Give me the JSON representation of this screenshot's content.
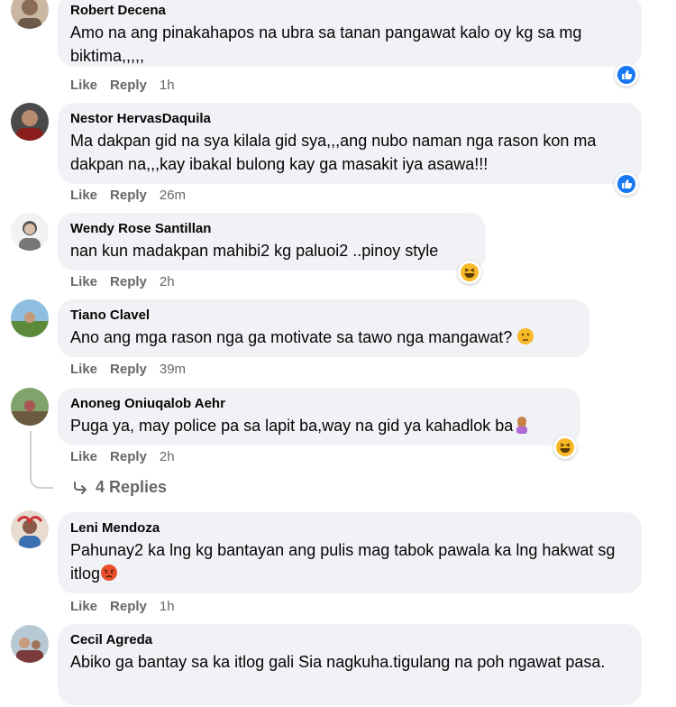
{
  "actions": {
    "like": "Like",
    "reply": "Reply"
  },
  "comments": [
    {
      "author": "Robert Decena",
      "text": "Amo na ang pinakahapos na ubra sa tanan pangawat kalo oy kg sa mg biktima,,,,,",
      "time": "1h",
      "reaction": "like-icon"
    },
    {
      "author": "Nestor HervasDaquila",
      "text": "Ma dakpan gid na sya kilala gid sya,,,ang nubo naman nga rason kon ma dakpan na,,,kay ibakal bulong kay ga masakit iya asawa!!!",
      "time": "26m",
      "reaction": "like-icon"
    },
    {
      "author": "Wendy Rose Santillan",
      "text": "nan kun madakpan mahibi2 kg paluoi2 ..pinoy style",
      "time": "2h",
      "reaction": "haha-icon"
    },
    {
      "author": "Tiano Clavel",
      "text": "Ano ang mga rason nga ga motivate sa tawo nga mangawat?",
      "time": "39m",
      "reaction": ""
    },
    {
      "author": "Anoneg Oniuqalob Aehr",
      "text": "Puga ya, may police pa sa lapit ba,way na gid ya kahadlok ba",
      "time": "2h",
      "reaction": "haha-icon"
    },
    {
      "author": "Leni Mendoza",
      "text": "Pahunay2 ka lng kg bantayan ang pulis mag tabok pawala ka lng hakwat sg itlog",
      "time": "1h",
      "reaction": ""
    },
    {
      "author": "Cecil Agreda",
      "text": "Abiko ga bantay sa ka itlog gali Sia nagkuha.tigulang na poh ngawat pasa.",
      "time": "",
      "reaction": ""
    }
  ],
  "replies_label": "4 Replies",
  "colors": {
    "bubble": "#f0f2f5",
    "meta": "#65676b",
    "like_blue": "#1877f2",
    "haha_yellow": "#f7b928"
  }
}
